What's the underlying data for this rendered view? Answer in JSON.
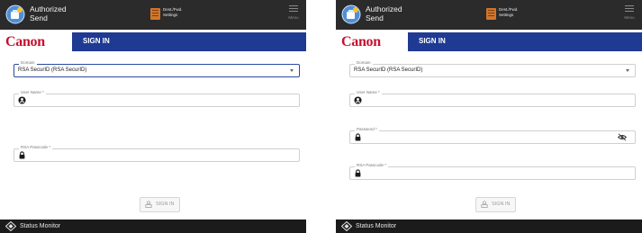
{
  "panels": [
    {
      "app_title": "Authorized\nSend",
      "dest_settings_label": "Dest./Fwd.\nSettings",
      "menu_label": "Menu",
      "logo": "Canon",
      "screen_title": "SIGN IN",
      "domain_label": "Domain",
      "domain_value": "RSA SecurID (RSA SecurID)",
      "username_label": "User Name *",
      "passcode_label": "RSA Passcode *",
      "signin_button": "SIGN IN",
      "status_monitor": "Status Monitor"
    },
    {
      "app_title": "Authorized\nSend",
      "dest_settings_label": "Dest./Fwd.\nSettings",
      "menu_label": "Menu",
      "logo": "Canon",
      "screen_title": "SIGN IN",
      "domain_label": "Domain",
      "domain_value": "RSA SecurID (RSA SecurID)",
      "username_label": "User Name *",
      "password_label": "Password *",
      "passcode_label": "RSA Passcode *",
      "signin_button": "SIGN IN",
      "status_monitor": "Status Monitor"
    }
  ],
  "colors": {
    "topbar": "#2b2b2b",
    "brandbar": "#1f3a93",
    "logo_red": "#c8102e",
    "statusbar": "#1b1b1b"
  },
  "icons": [
    "authorized-send-app-icon",
    "document-icon",
    "hamburger-menu-icon",
    "chevron-down-icon",
    "user-icon",
    "lock-icon",
    "eye-slash-icon",
    "status-monitor-icon"
  ]
}
